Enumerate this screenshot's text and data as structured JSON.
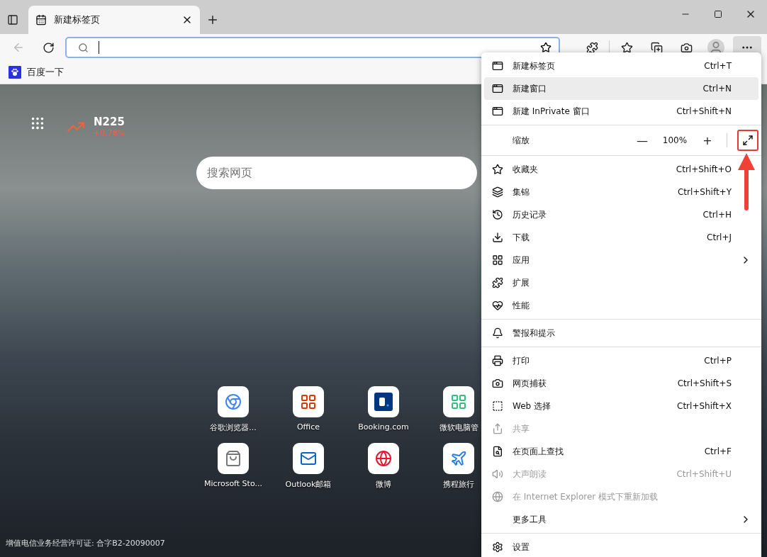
{
  "tab": {
    "title": "新建标签页",
    "selected": true
  },
  "bookmarks": [
    {
      "label": "百度一下"
    }
  ],
  "newtab": {
    "ticker": {
      "name": "N225",
      "change": "+0.78%"
    },
    "search": {
      "placeholder": "搜索网页"
    },
    "quick_links": [
      {
        "label": "谷歌浏览器..."
      },
      {
        "label": "Office"
      },
      {
        "label": "Booking.com"
      },
      {
        "label": "微软电脑管"
      },
      {
        "label": "Microsoft Sto..."
      },
      {
        "label": "Outlook邮箱"
      },
      {
        "label": "微博"
      },
      {
        "label": "携程旅行"
      }
    ],
    "footer": "增值电信业务经营许可证: 合字B2-20090007"
  },
  "menu": [
    {
      "kind": "item",
      "label": "新建标签页",
      "shortcut": "Ctrl+T",
      "selected": false,
      "disabled": false
    },
    {
      "kind": "item",
      "label": "新建窗口",
      "shortcut": "Ctrl+N",
      "selected": true,
      "disabled": false
    },
    {
      "kind": "item",
      "label": "新建 InPrivate 窗口",
      "shortcut": "Ctrl+Shift+N",
      "selected": false,
      "disabled": false
    },
    {
      "kind": "divider"
    },
    {
      "kind": "zoom",
      "label": "缩放",
      "value": "100%",
      "minus": "—",
      "plus": "+",
      "highlighted": true
    },
    {
      "kind": "divider"
    },
    {
      "kind": "item",
      "label": "收藏夹",
      "shortcut": "Ctrl+Shift+O",
      "selected": false,
      "disabled": false
    },
    {
      "kind": "item",
      "label": "集锦",
      "shortcut": "Ctrl+Shift+Y",
      "selected": false,
      "disabled": false
    },
    {
      "kind": "item",
      "label": "历史记录",
      "shortcut": "Ctrl+H",
      "selected": false,
      "disabled": false
    },
    {
      "kind": "item",
      "label": "下载",
      "shortcut": "Ctrl+J",
      "selected": false,
      "disabled": false
    },
    {
      "kind": "item",
      "label": "应用",
      "submenu": true,
      "selected": false,
      "disabled": false
    },
    {
      "kind": "item",
      "label": "扩展",
      "selected": false,
      "disabled": false
    },
    {
      "kind": "item",
      "label": "性能",
      "selected": false,
      "disabled": false
    },
    {
      "kind": "divider"
    },
    {
      "kind": "item",
      "label": "警报和提示",
      "selected": false,
      "disabled": false
    },
    {
      "kind": "divider"
    },
    {
      "kind": "item",
      "label": "打印",
      "shortcut": "Ctrl+P",
      "selected": false,
      "disabled": false
    },
    {
      "kind": "item",
      "label": "网页捕获",
      "shortcut": "Ctrl+Shift+S",
      "selected": false,
      "disabled": false
    },
    {
      "kind": "item",
      "label": "Web 选择",
      "shortcut": "Ctrl+Shift+X",
      "selected": false,
      "disabled": false
    },
    {
      "kind": "item",
      "label": "共享",
      "selected": false,
      "disabled": true
    },
    {
      "kind": "item",
      "label": "在页面上查找",
      "shortcut": "Ctrl+F",
      "selected": false,
      "disabled": false
    },
    {
      "kind": "item",
      "label": "大声朗读",
      "shortcut": "Ctrl+Shift+U",
      "selected": false,
      "disabled": true
    },
    {
      "kind": "item",
      "label": "在 Internet Explorer 模式下重新加载",
      "selected": false,
      "disabled": true
    },
    {
      "kind": "item",
      "label": "更多工具",
      "submenu": true,
      "selected": false,
      "disabled": false
    },
    {
      "kind": "divider"
    },
    {
      "kind": "item",
      "label": "设置",
      "selected": false,
      "disabled": false
    }
  ]
}
